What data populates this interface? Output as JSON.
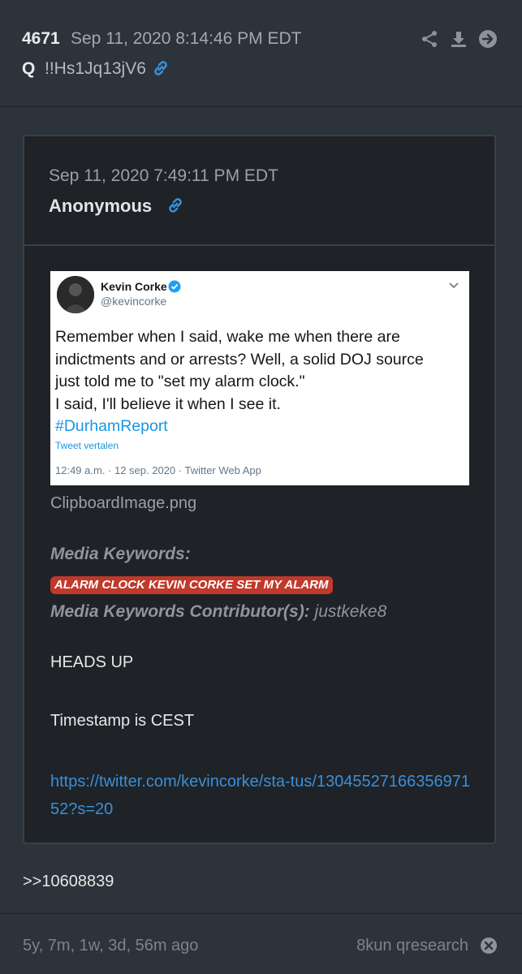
{
  "header": {
    "post_number": "4671",
    "timestamp": "Sep 11, 2020 8:14:46 PM EDT",
    "author": "Q",
    "tripcode": "!!Hs1Jq13jV6"
  },
  "quoted_post": {
    "timestamp": "Sep 11, 2020 7:49:11 PM EDT",
    "author": "Anonymous",
    "tweet": {
      "name": "Kevin Corke",
      "handle": "@kevincorke",
      "lines": [
        "Remember when I said, wake me when there are",
        "indictments and or arrests?  Well, a solid DOJ source",
        "just told me to \"set my alarm clock.\"",
        "I said, I'll believe it when I see it."
      ],
      "hashtag": "#DurhamReport",
      "translate_label": "Tweet vertalen",
      "meta": "12:49 a.m. · 12 sep. 2020 · Twitter Web App"
    },
    "filename": "ClipboardImage.png",
    "media_keywords_label": "Media Keywords:",
    "media_keywords": "ALARM CLOCK KEVIN CORKE SET MY ALARM",
    "contributors_label": "Media Keywords Contributor(s):",
    "contributor": "justkeke8",
    "body_line_1": "HEADS UP",
    "body_line_2": "Timestamp is CEST",
    "link": "https://twitter.com/kevincorke/sta-tus/1304552716635697152?s=20"
  },
  "reply_reference": ">>10608839",
  "footer": {
    "age": "5y, 7m, 1w, 3d, 56m ago",
    "source": "8kun qresearch"
  },
  "colors": {
    "background": "#2d333a",
    "quote_background": "#1f2226",
    "link": "#3a8fd9",
    "keyword_badge": "#c0392b"
  },
  "icons": [
    "share-icon",
    "download-icon",
    "arrow-right-circle-icon",
    "link-icon",
    "verified-badge-icon",
    "chevron-down-icon",
    "close-circle-icon"
  ]
}
